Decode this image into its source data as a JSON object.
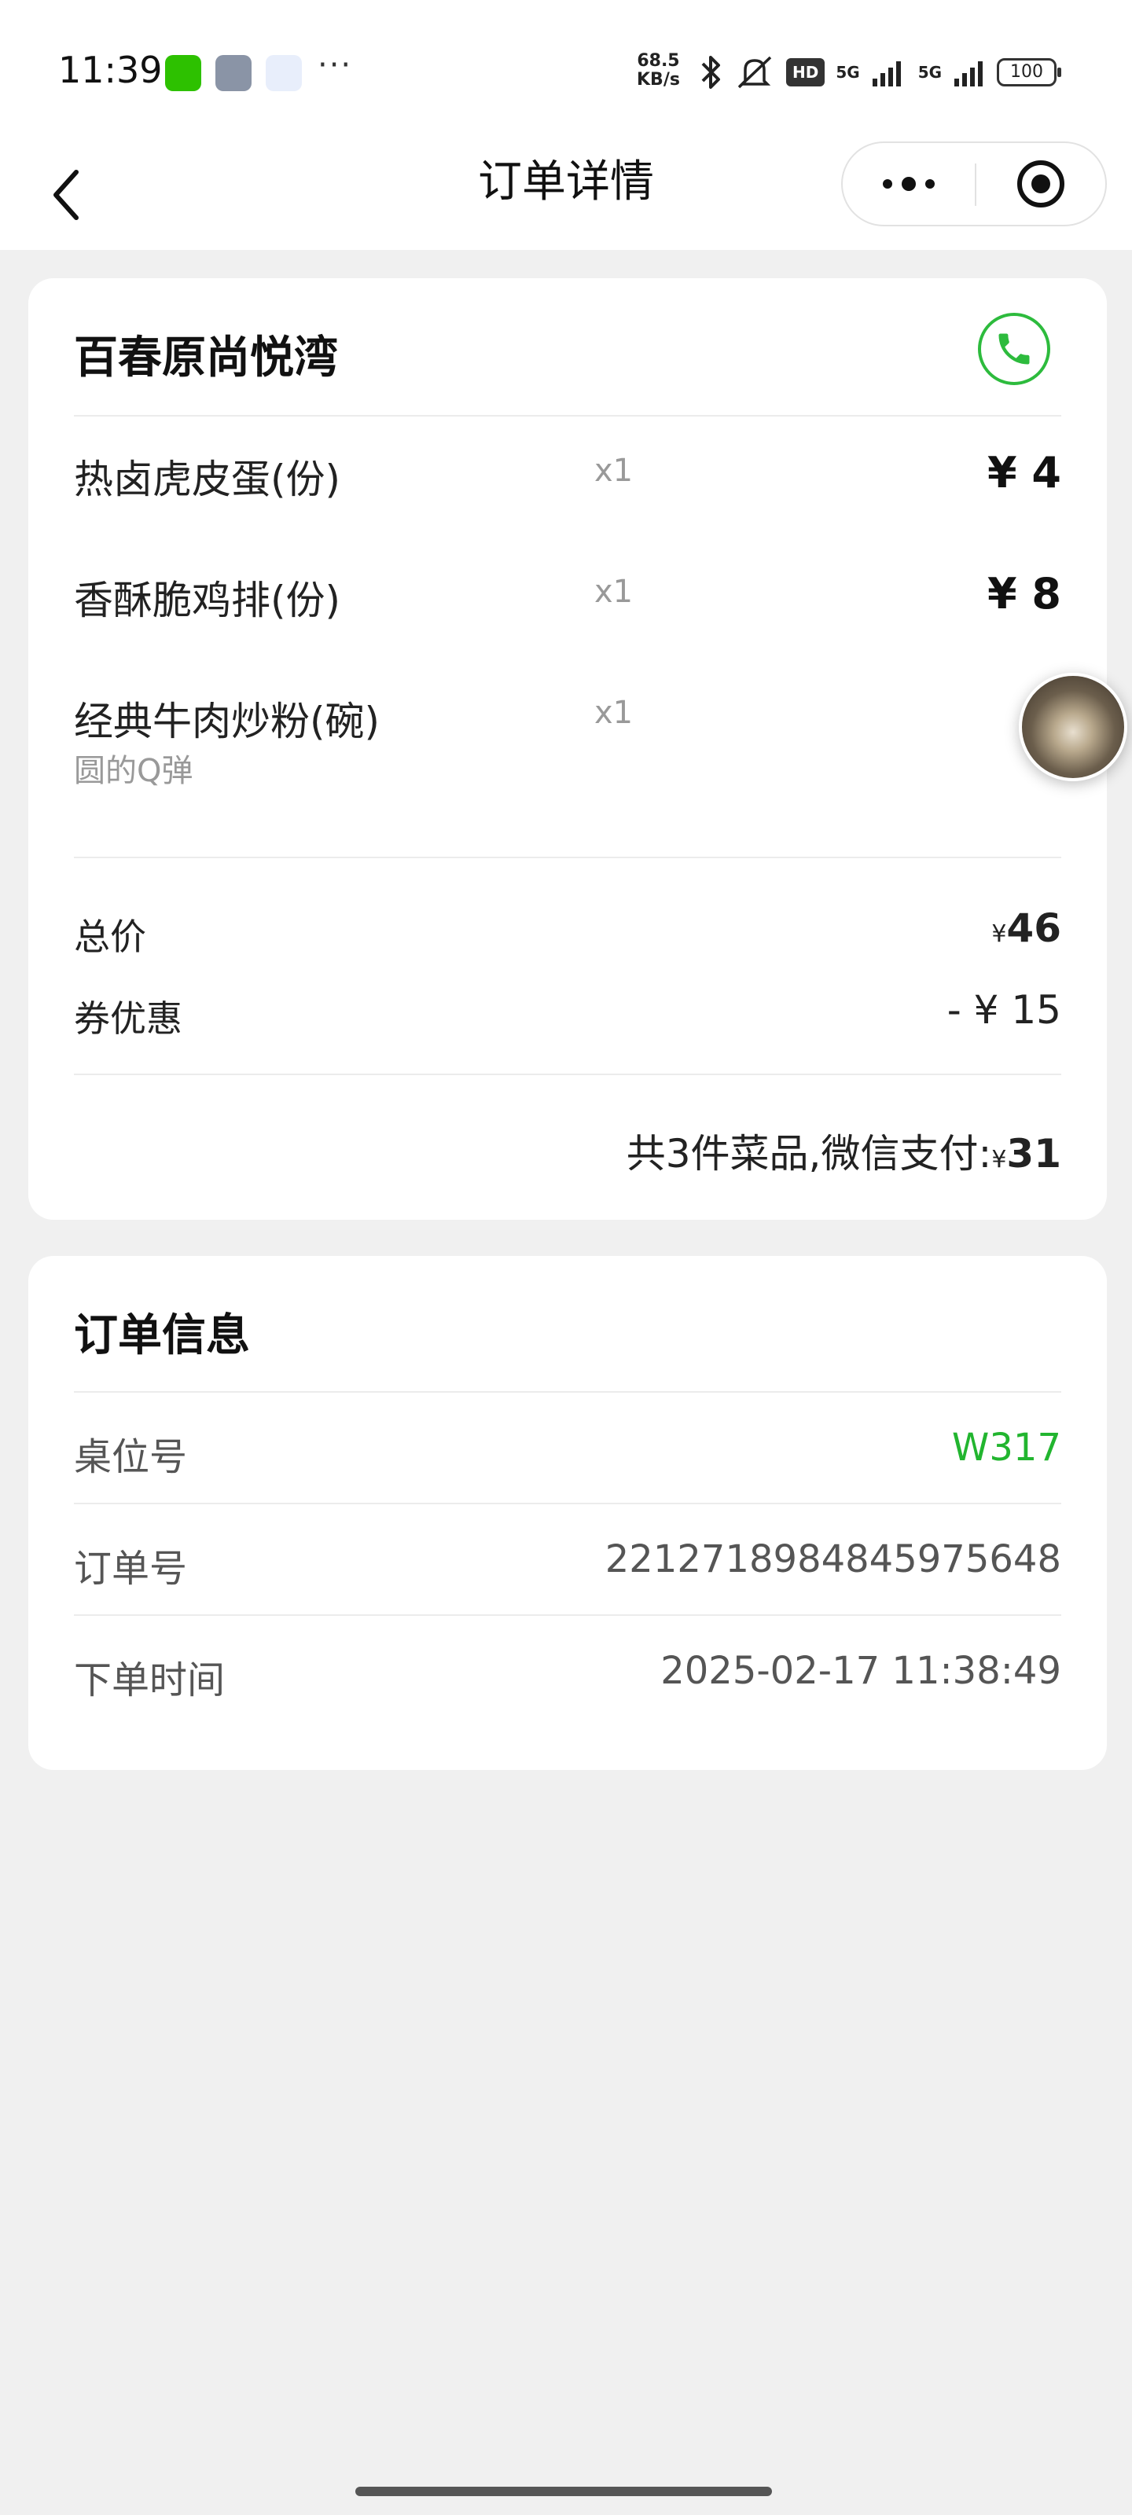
{
  "status_bar": {
    "time": "11:39",
    "speed_value": "68.5",
    "speed_unit": "KB/s",
    "hd_label": "HD",
    "network_1": "5G",
    "network_2": "5G",
    "battery": "100",
    "more": "···"
  },
  "nav": {
    "title": "订单详情"
  },
  "shop": {
    "name": "百春原尚悦湾",
    "items": [
      {
        "name": "热卤虎皮蛋(份)",
        "desc": "",
        "qty": "x1",
        "price": "¥ 4"
      },
      {
        "name": "香酥脆鸡排(份)",
        "desc": "",
        "qty": "x1",
        "price": "¥ 8"
      },
      {
        "name": "经典牛肉炒粉(碗)",
        "desc": "圆的Q弹",
        "qty": "x1",
        "price": "¥ "
      }
    ],
    "total_label": "总价",
    "total_yen": "¥",
    "total_value": "46",
    "coupon_label": "券优惠",
    "coupon_value": "- ¥ 15",
    "pay_text": "共3件菜品,微信支付:",
    "pay_yen": "¥",
    "pay_value": "31"
  },
  "order_info": {
    "title": "订单信息",
    "table_label": "桌位号",
    "table_value": "W317",
    "order_no_label": "订单号",
    "order_no_value": "2212718984845975648",
    "time_label": "下单时间",
    "time_value": "2025-02-17 11:38:49"
  },
  "colors": {
    "accent_green": "#22b52f",
    "background": "#f0f0f0"
  },
  "icons": [
    "back-arrow-icon",
    "more-dots-icon",
    "target-close-icon",
    "phone-icon",
    "wechat-icon",
    "tool-icon",
    "miniapp-icon",
    "bluetooth-icon",
    "mute-icon",
    "signal-icon",
    "battery-icon"
  ]
}
